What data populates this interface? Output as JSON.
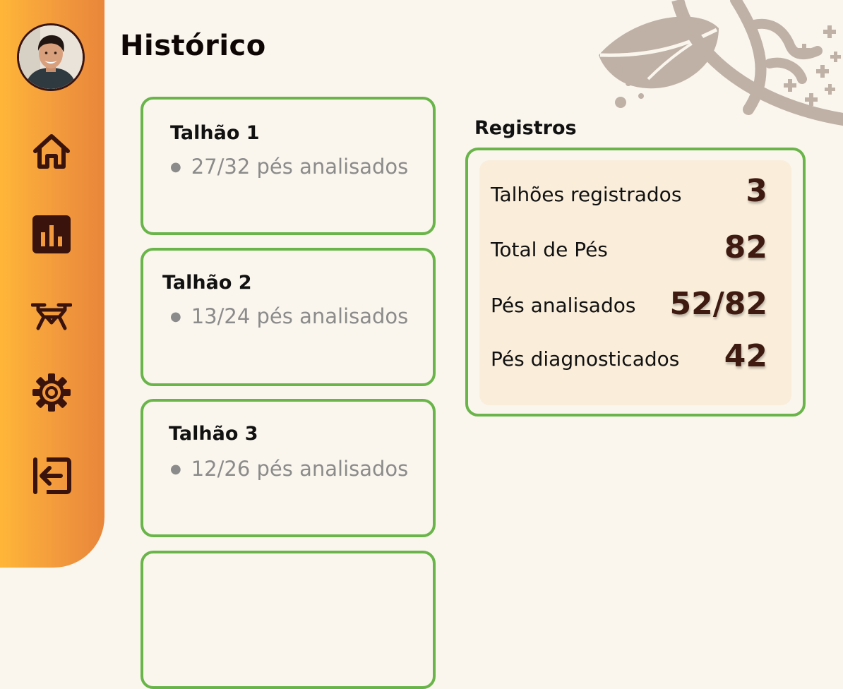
{
  "page": {
    "title": "Histórico"
  },
  "sidebar": {
    "items": [
      {
        "icon": "home-icon"
      },
      {
        "icon": "bar-chart-icon"
      },
      {
        "icon": "drone-icon"
      },
      {
        "icon": "gear-icon"
      },
      {
        "icon": "logout-icon"
      }
    ]
  },
  "plots": [
    {
      "name": "Talhão 1",
      "progress": "27/32 pés analisados"
    },
    {
      "name": "Talhão 2",
      "progress": "13/24 pés analisados"
    },
    {
      "name": "Talhão 3",
      "progress": "12/26 pés analisados"
    }
  ],
  "registros": {
    "title": "Registros",
    "stats": [
      {
        "label": "Talhões registrados",
        "value": "3"
      },
      {
        "label": "Total de Pés",
        "value": "82"
      },
      {
        "label": "Pés analisados",
        "value": "52/82"
      },
      {
        "label": "Pés diagnosticados",
        "value": "42"
      }
    ]
  },
  "colors": {
    "accent_green": "#6ab54a",
    "sidebar_orange": "#f29a3d",
    "dark_brown": "#3f1a10",
    "background": "#faf6ee"
  }
}
